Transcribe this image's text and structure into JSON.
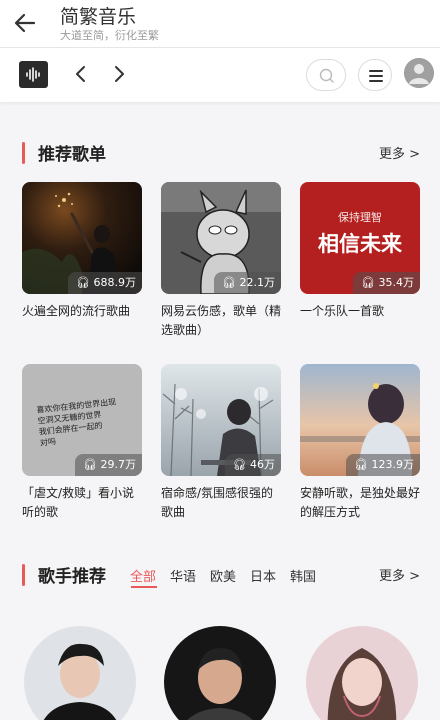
{
  "header": {
    "title": "简繁音乐",
    "subtitle": "大道至简，衍化至繁"
  },
  "toolbar": {
    "logo_icon": "waveform-icon",
    "prev_icon": "chevron-left-icon",
    "next_icon": "chevron-right-icon",
    "search_icon": "search-icon",
    "menu_icon": "menu-icon"
  },
  "playlists_section": {
    "title": "推荐歌单",
    "more": "更多 >",
    "items": [
      {
        "title": "火遍全网的流行歌曲",
        "plays": "688.9万",
        "cover_text": ""
      },
      {
        "title": "网易云伤感，歌单（精选歌曲）",
        "plays": "22.1万",
        "cover_text": ""
      },
      {
        "title": "一个乐队一首歌",
        "plays": "35.4万",
        "cover_text_top": "保持理智",
        "cover_text_main": "相信未来"
      },
      {
        "title": "「虐文/救赎」看小说听的歌",
        "plays": "29.7万",
        "cover_text_lines": [
          "喜欢你在我的世界出现",
          "空洞又无糖的世界",
          "我们会胖在一起的",
          "对吗"
        ]
      },
      {
        "title": "宿命感/氛围感很强的歌曲",
        "plays": "46万",
        "cover_text": ""
      },
      {
        "title": "安静听歌，是独处最好的解压方式",
        "plays": "123.9万",
        "cover_text": ""
      }
    ]
  },
  "artists_section": {
    "title": "歌手推荐",
    "more": "更多 >",
    "tabs": [
      "全部",
      "华语",
      "欧美",
      "日本",
      "韩国"
    ],
    "active_tab": "全部"
  },
  "colors": {
    "accent": "#e85a5a",
    "background": "#f5f5f7"
  }
}
